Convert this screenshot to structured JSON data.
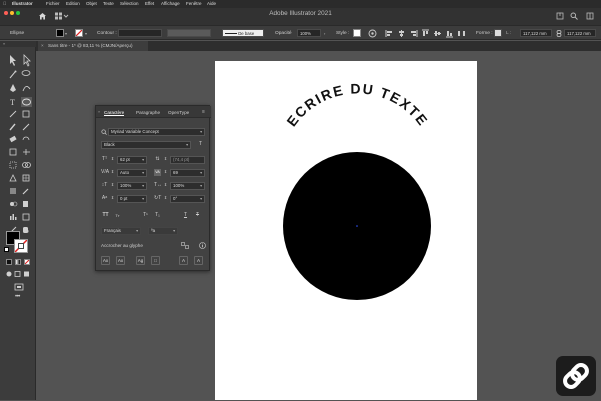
{
  "menubar": {
    "items": [
      "Illustrator",
      "Fichier",
      "Edition",
      "Objet",
      "Texte",
      "Sélection",
      "Effet",
      "Affichage",
      "Fenêtre",
      "Aide"
    ]
  },
  "app": {
    "title": "Adobe Illustrator 2021"
  },
  "controlbar": {
    "object_label": "Ellipse",
    "contour_label": "Contour :",
    "stroke_profile": "De base",
    "opacity_label": "Opacité",
    "opacity_value": "100%",
    "style_label": "Style :",
    "shape_label": "Forme :",
    "width_value": "117,122 mm",
    "height_value": "117,122 mm"
  },
  "document": {
    "tab_title": "Sans titre - 1* @ 83,11 % (CMJN/Aperçu)"
  },
  "canvas": {
    "curved_text": "ECRIRE DU TEXTE",
    "circle_color": "#000000"
  },
  "character_panel": {
    "tabs": [
      "Caractère",
      "Paragraphe",
      "OpenType"
    ],
    "font_family": "Myriad Variable Concept",
    "font_style": "Black",
    "font_size": "62 pt",
    "leading": "(74,4 pt)",
    "kerning": "Auto",
    "tracking": "69",
    "vertical_scale": "100%",
    "horizontal_scale": "100%",
    "baseline_shift": "0 pt",
    "rotation": "0°",
    "language": "Français",
    "aa_label": "ªa",
    "snap_label": "Accrocher au glyphe"
  },
  "logo": {
    "name": "chain-link-icon"
  }
}
